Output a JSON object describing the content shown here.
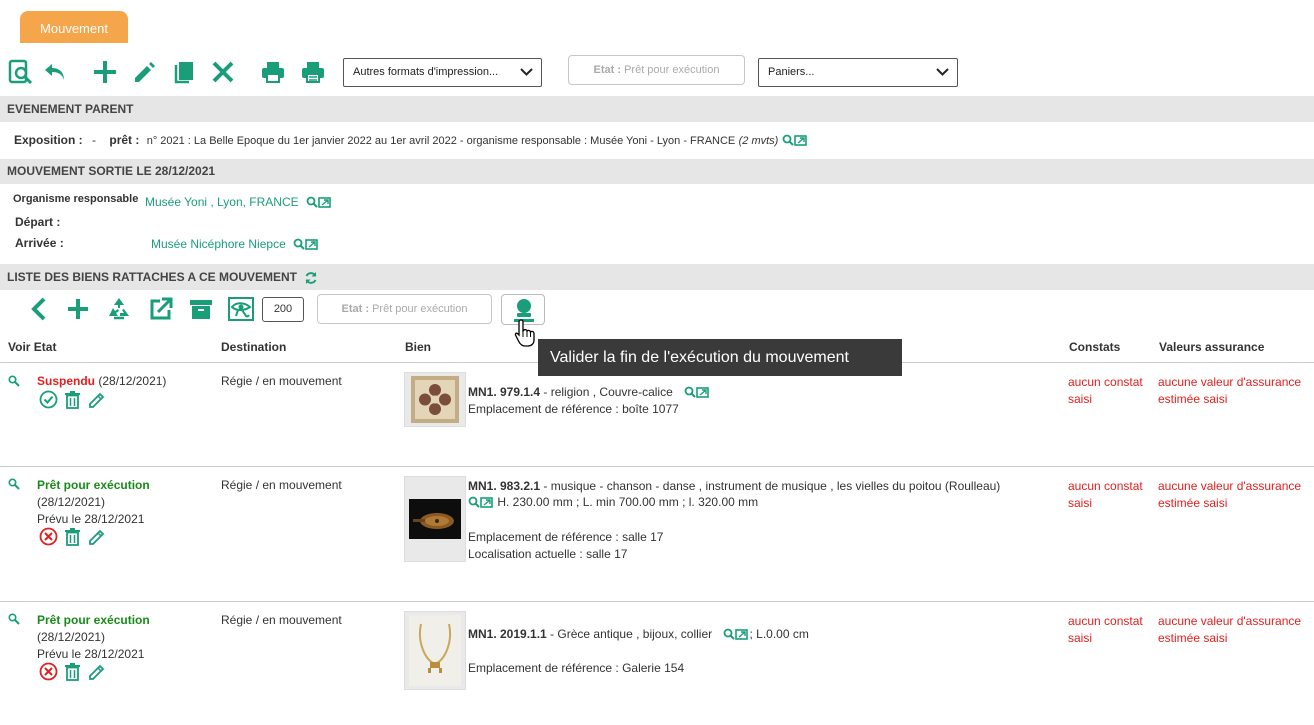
{
  "tab": {
    "label": "Mouvement"
  },
  "toolbar": {
    "format_select": "Autres formats d'impression...",
    "etat_prefix": "Etat :",
    "etat_value": "Prêt pour exécution",
    "paniers_select": "Paniers..."
  },
  "evenement": {
    "title": "EVENEMENT PARENT",
    "exposition_label": "Exposition :",
    "exposition_value": "-",
    "pret_label": "prêt :",
    "pret_value": "n° 2021 : La Belle Epoque du 1er janvier 2022 au 1er avril 2022 - organisme responsable : Musée Yoni - Lyon - FRANCE",
    "pret_count": "(2 mvts)"
  },
  "mouvement": {
    "title": "MOUVEMENT SORTIE LE 28/12/2021",
    "organisme_label": "Organisme responsable",
    "organisme_value": "Musée Yoni , Lyon, FRANCE",
    "depart_label": "Départ :",
    "arrivee_label": "Arrivée :",
    "arrivee_value": "Musée Nicéphore Niepce"
  },
  "liste": {
    "title": "LISTE DES BIENS RATTACHES A CE MOUVEMENT",
    "count": "200",
    "etat_prefix": "Etat :",
    "etat_value": "Prêt pour exécution",
    "tooltip": "Valider la fin de l'exécution du mouvement",
    "headers": {
      "voir_etat": "Voir Etat",
      "destination": "Destination",
      "bien": "Bien",
      "constats": "Constats",
      "valeurs": "Valeurs assurance"
    },
    "rows": [
      {
        "status": "Suspendu",
        "date": "(28/12/2021)",
        "prevu": "",
        "destination": "Régie / en mouvement",
        "inv": "MN1. 979.1.4",
        "desc": " - religion , Couvre-calice",
        "dims": "",
        "line2": "Emplacement de référence : boîte 1077",
        "line3": "",
        "constat": "aucun constat saisi",
        "valeur": "aucune valeur d'assurance estimée saisi",
        "status_color": "#e02020"
      },
      {
        "status": "Prêt pour exécution",
        "date": "(28/12/2021)",
        "prevu": "Prévu le 28/12/2021",
        "destination": "Régie / en mouvement",
        "inv": "MN1. 983.2.1",
        "desc": " - musique - chanson - danse , instrument de musique , les vielles du poitou (Roulleau)",
        "dims": "H. 230.00 mm ; L. min 700.00 mm ; l. 320.00 mm",
        "line2": "Emplacement de référence : salle 17",
        "line3": "Localisation actuelle : salle 17",
        "constat": "aucun constat saisi",
        "valeur": "aucune valeur d'assurance estimée saisi",
        "status_color": "#1a8a1a"
      },
      {
        "status": "Prêt pour exécution",
        "date": "(28/12/2021)",
        "prevu": "Prévu le 28/12/2021",
        "destination": "Régie / en mouvement",
        "inv": "MN1. 2019.1.1",
        "desc": " - Grèce antique , bijoux, collier",
        "dims": "; L.0.00 cm",
        "line2": "Emplacement de référence : Galerie 154",
        "line3": "",
        "constat": "aucun constat saisi",
        "valeur": "aucune valeur d'assurance estimée saisi",
        "status_color": "#1a8a1a"
      }
    ]
  },
  "colors": {
    "accent": "#1a9e7a",
    "tab": "#f5a54a",
    "alert": "#e02020",
    "ok": "#1a8a1a"
  }
}
